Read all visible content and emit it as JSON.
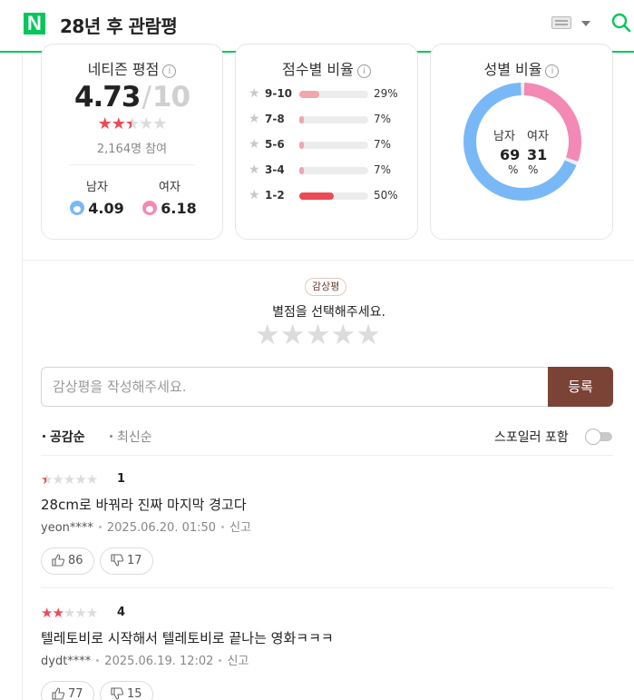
{
  "header": {
    "logo": "N",
    "title": "28년 후 관람평"
  },
  "netizen": {
    "title": "네티즌 평점",
    "score": "4.73",
    "max": "10",
    "participants": "2,164명 참여",
    "male_label": "남자",
    "male_score": "4.09",
    "female_label": "여자",
    "female_score": "6.18"
  },
  "distribution": {
    "title": "점수별 비율",
    "rows": [
      {
        "label": "9-10",
        "percent": "29%",
        "fill": 0.29
      },
      {
        "label": "7-8",
        "percent": "7%",
        "fill": 0.07
      },
      {
        "label": "5-6",
        "percent": "7%",
        "fill": 0.07
      },
      {
        "label": "3-4",
        "percent": "7%",
        "fill": 0.07
      },
      {
        "label": "1-2",
        "percent": "50%",
        "fill": 0.5
      }
    ],
    "fill_color_light": "#f2a5ab",
    "fill_color_strong": "#ec4a55"
  },
  "gender": {
    "title": "성별 비율",
    "male_label": "남자",
    "female_label": "여자",
    "male_value": "69",
    "female_value": "31",
    "unit": "%",
    "male_color": "#79b8f6",
    "female_color": "#f389b4"
  },
  "write": {
    "tag": "감상평",
    "prompt": "별점을 선택해주세요.",
    "placeholder": "감상평을 작성해주세요.",
    "submit_label": "등록"
  },
  "sort": {
    "options": [
      "공감순",
      "최신순"
    ],
    "spoiler_label": "스포일러 포함"
  },
  "reviews": [
    {
      "score": "1",
      "text": "28cm로 바꿔라 진짜 마지막 경고다",
      "user": "yeon****",
      "date": "2025.06.20. 01:50",
      "report": "신고",
      "likes": "86",
      "dislikes": "17"
    },
    {
      "score": "4",
      "text": "텔레토비로 시작해서 텔레토비로 끝나는 영화ㅋㅋㅋ",
      "user": "dydt****",
      "date": "2025.06.19. 12:02",
      "report": "신고",
      "likes": "77",
      "dislikes": "15"
    }
  ]
}
